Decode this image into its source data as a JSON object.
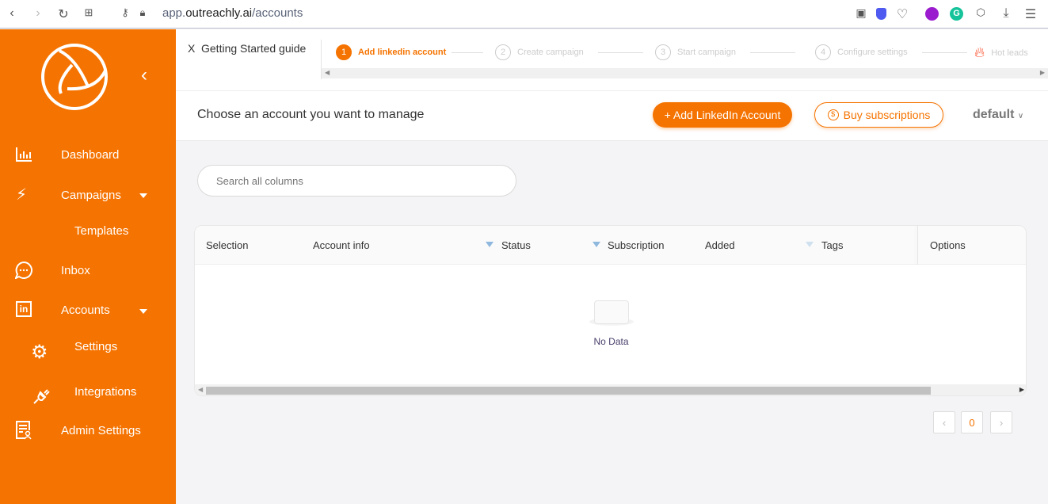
{
  "browser": {
    "url_prefix": "app.",
    "url_domain": "outreachly.ai",
    "url_path": "/accounts"
  },
  "sidebar": {
    "items": [
      {
        "label": "Dashboard",
        "icon": "bar-chart-icon"
      },
      {
        "label": "Campaigns",
        "icon": "lightning-icon"
      },
      {
        "label": "Templates"
      },
      {
        "label": "Inbox",
        "icon": "chat-icon"
      },
      {
        "label": "Accounts",
        "icon": "linkedin-icon"
      },
      {
        "label": "Settings",
        "icon": "gear-icon"
      },
      {
        "label": "Integrations",
        "icon": "plug-icon"
      },
      {
        "label": "Admin Settings",
        "icon": "admin-doc-icon"
      }
    ]
  },
  "guide": {
    "close_label": "X",
    "title": "Getting Started guide",
    "steps": [
      {
        "num": "1",
        "label": "Add linkedin account",
        "active": true
      },
      {
        "num": "2",
        "label": "Create campaign"
      },
      {
        "num": "3",
        "label": "Start campaign"
      },
      {
        "num": "4",
        "label": "Configure settings"
      },
      {
        "label": "Hot leads",
        "icon": "fire-icon"
      }
    ]
  },
  "header": {
    "title": "Choose an account you want to manage",
    "add_button": "+ Add LinkedIn Account",
    "buy_button": "Buy subscriptions",
    "workspace": "default"
  },
  "search": {
    "placeholder": "Search all columns"
  },
  "table": {
    "columns": [
      "Selection",
      "Account info",
      "Status",
      "Subscription",
      "Added",
      "Tags",
      "Options"
    ],
    "empty_text": "No Data"
  },
  "pagination": {
    "current": "0"
  },
  "colors": {
    "brand": "#f57300",
    "background": "#f4f4f6"
  }
}
